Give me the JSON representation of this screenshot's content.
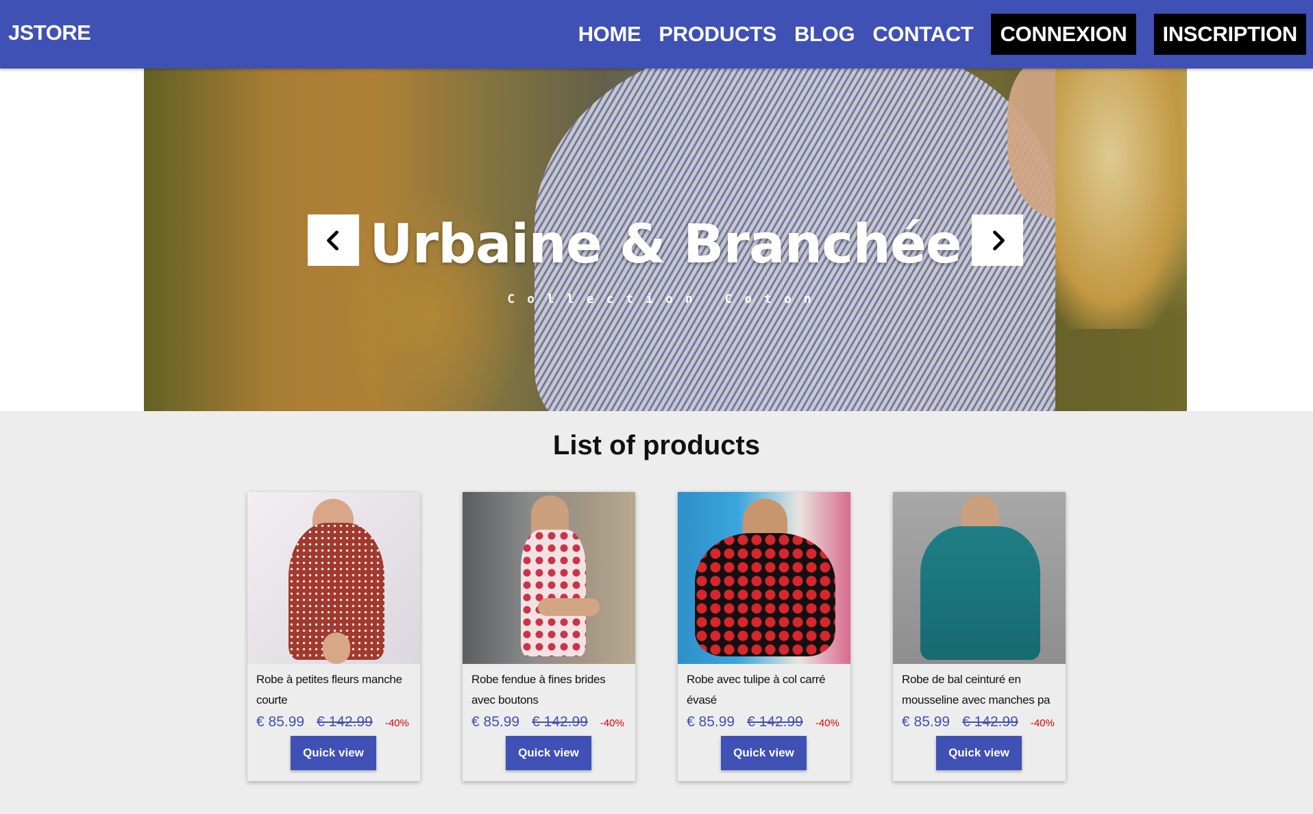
{
  "nav": {
    "brand": "JSTORE",
    "links": [
      "HOME",
      "PRODUCTS",
      "BLOG",
      "CONTACT"
    ],
    "login_label": "CONNEXION",
    "signup_label": "INSCRIPTION"
  },
  "hero": {
    "title": "Urbaine & Branchée",
    "subtitle": "Collection Coton",
    "prev_icon": "chevron-left-icon",
    "next_icon": "chevron-right-icon"
  },
  "products_section": {
    "title": "List of products",
    "quick_view_label": "Quick view",
    "items": [
      {
        "name": "Robe à petites fleurs manche courte",
        "price": "€ 85.99",
        "old_price": "€ 142.99",
        "discount": "-40%"
      },
      {
        "name": "Robe fendue à fines brides avec boutons",
        "price": "€ 85.99",
        "old_price": "€ 142.99",
        "discount": "-40%"
      },
      {
        "name": "Robe avec tulipe à col carré évasé",
        "price": "€ 85.99",
        "old_price": "€ 142.99",
        "discount": "-40%"
      },
      {
        "name": "Robe de bal ceinturé en mousseline avec manches pa ...",
        "price": "€ 85.99",
        "old_price": "€ 142.99",
        "discount": "-40%"
      }
    ]
  },
  "colors": {
    "primary": "#3f51b5",
    "nav_button_bg": "#000000",
    "discount": "#dd0000",
    "page_bg": "#ededed"
  }
}
